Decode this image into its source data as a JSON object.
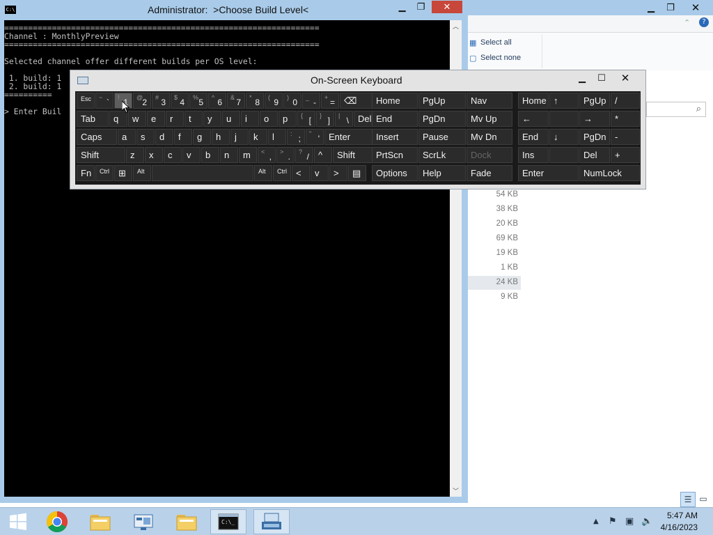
{
  "explorer": {
    "ribbon": {
      "select_all": "Select all",
      "select_none": "Select none"
    },
    "file_sizes": [
      "54 KB",
      "38 KB",
      "20 KB",
      "69 KB",
      "19 KB",
      "1 KB",
      "24 KB",
      "9 KB"
    ]
  },
  "console": {
    "title": "Administrator:  >Choose Build Level<",
    "lines": [
      "==================================================================",
      "Channel : MonthlyPreview",
      "==================================================================",
      "",
      "Selected channel offer different builds per OS level:",
      "",
      " 1. build: 1",
      " 2. build: 1",
      "==========",
      "",
      "> Enter Buil"
    ]
  },
  "osk": {
    "title": "On-Screen Keyboard",
    "rows": [
      [
        {
          "id": "esc",
          "label": "Esc",
          "small": true
        },
        {
          "id": "backtick",
          "sub": "~",
          "main": "`"
        },
        {
          "id": "1",
          "sub": "!",
          "main": "1",
          "pressed": true
        },
        {
          "id": "2",
          "sub": "@",
          "main": "2"
        },
        {
          "id": "3",
          "sub": "#",
          "main": "3"
        },
        {
          "id": "4",
          "sub": "$",
          "main": "4"
        },
        {
          "id": "5",
          "sub": "%",
          "main": "5"
        },
        {
          "id": "6",
          "sub": "^",
          "main": "6"
        },
        {
          "id": "7",
          "sub": "&",
          "main": "7"
        },
        {
          "id": "8",
          "sub": "*",
          "main": "8"
        },
        {
          "id": "9",
          "sub": "(",
          "main": "9"
        },
        {
          "id": "0",
          "sub": ")",
          "main": "0"
        },
        {
          "id": "minus",
          "sub": "_",
          "main": "-"
        },
        {
          "id": "equals",
          "sub": "+",
          "main": "="
        },
        {
          "id": "backspace",
          "label": "⌫"
        }
      ],
      [
        {
          "id": "tab",
          "label": "Tab"
        },
        {
          "id": "q",
          "label": "q"
        },
        {
          "id": "w",
          "label": "w"
        },
        {
          "id": "e",
          "label": "e"
        },
        {
          "id": "r",
          "label": "r"
        },
        {
          "id": "t",
          "label": "t"
        },
        {
          "id": "y",
          "label": "y"
        },
        {
          "id": "u",
          "label": "u"
        },
        {
          "id": "i",
          "label": "i"
        },
        {
          "id": "o",
          "label": "o"
        },
        {
          "id": "p",
          "label": "p"
        },
        {
          "id": "lbracket",
          "sub": "{",
          "main": "["
        },
        {
          "id": "rbracket",
          "sub": "}",
          "main": "]"
        },
        {
          "id": "backslash",
          "sub": "|",
          "main": "\\"
        },
        {
          "id": "del",
          "label": "Del"
        }
      ],
      [
        {
          "id": "caps",
          "label": "Caps"
        },
        {
          "id": "a",
          "label": "a"
        },
        {
          "id": "s",
          "label": "s"
        },
        {
          "id": "d",
          "label": "d"
        },
        {
          "id": "f",
          "label": "f"
        },
        {
          "id": "g",
          "label": "g"
        },
        {
          "id": "h",
          "label": "h"
        },
        {
          "id": "j",
          "label": "j"
        },
        {
          "id": "k",
          "label": "k"
        },
        {
          "id": "l",
          "label": "l"
        },
        {
          "id": "semicolon",
          "sub": ":",
          "main": ";"
        },
        {
          "id": "quote",
          "sub": "\"",
          "main": "'"
        },
        {
          "id": "enter",
          "label": "Enter"
        }
      ],
      [
        {
          "id": "shift-left",
          "label": "Shift"
        },
        {
          "id": "z",
          "label": "z"
        },
        {
          "id": "x",
          "label": "x"
        },
        {
          "id": "c",
          "label": "c"
        },
        {
          "id": "v",
          "label": "v"
        },
        {
          "id": "b",
          "label": "b"
        },
        {
          "id": "n",
          "label": "n"
        },
        {
          "id": "m",
          "label": "m"
        },
        {
          "id": "comma",
          "sub": "<",
          "main": ","
        },
        {
          "id": "period",
          "sub": ">",
          "main": "."
        },
        {
          "id": "slash",
          "sub": "?",
          "main": "/"
        },
        {
          "id": "up",
          "label": "^"
        },
        {
          "id": "shift-right",
          "label": "Shift"
        }
      ],
      [
        {
          "id": "fn",
          "label": "Fn"
        },
        {
          "id": "ctrl-left",
          "label": "Ctrl",
          "small": true
        },
        {
          "id": "win",
          "label": "⊞"
        },
        {
          "id": "alt-left",
          "label": "Alt",
          "small": true
        },
        {
          "id": "space",
          "label": ""
        },
        {
          "id": "alt-right",
          "label": "Alt",
          "small": true
        },
        {
          "id": "ctrl-right",
          "label": "Ctrl",
          "small": true
        },
        {
          "id": "left",
          "label": "<"
        },
        {
          "id": "down",
          "label": "v"
        },
        {
          "id": "right",
          "label": ">"
        },
        {
          "id": "menu",
          "label": "▤"
        }
      ]
    ],
    "nav_keys": [
      [
        "Home",
        "PgUp",
        "Nav"
      ],
      [
        "End",
        "PgDn",
        "Mv Up"
      ],
      [
        "Insert",
        "Pause",
        "Mv Dn"
      ],
      [
        "PrtScn",
        "ScrLk",
        "Dock"
      ],
      [
        "Options",
        "Help",
        "Fade"
      ]
    ],
    "numpad_keys": [
      [
        "Home",
        "↑",
        "PgUp",
        "/"
      ],
      [
        "←",
        "",
        "→",
        "*"
      ],
      [
        "End",
        "↓",
        "PgDn",
        "-"
      ],
      [
        "Ins",
        "",
        "Del",
        "+"
      ],
      [
        "Enter",
        "",
        "NumLock",
        ""
      ]
    ]
  },
  "taskbar": {
    "time": "5:47 AM",
    "date": "4/16/2023"
  }
}
